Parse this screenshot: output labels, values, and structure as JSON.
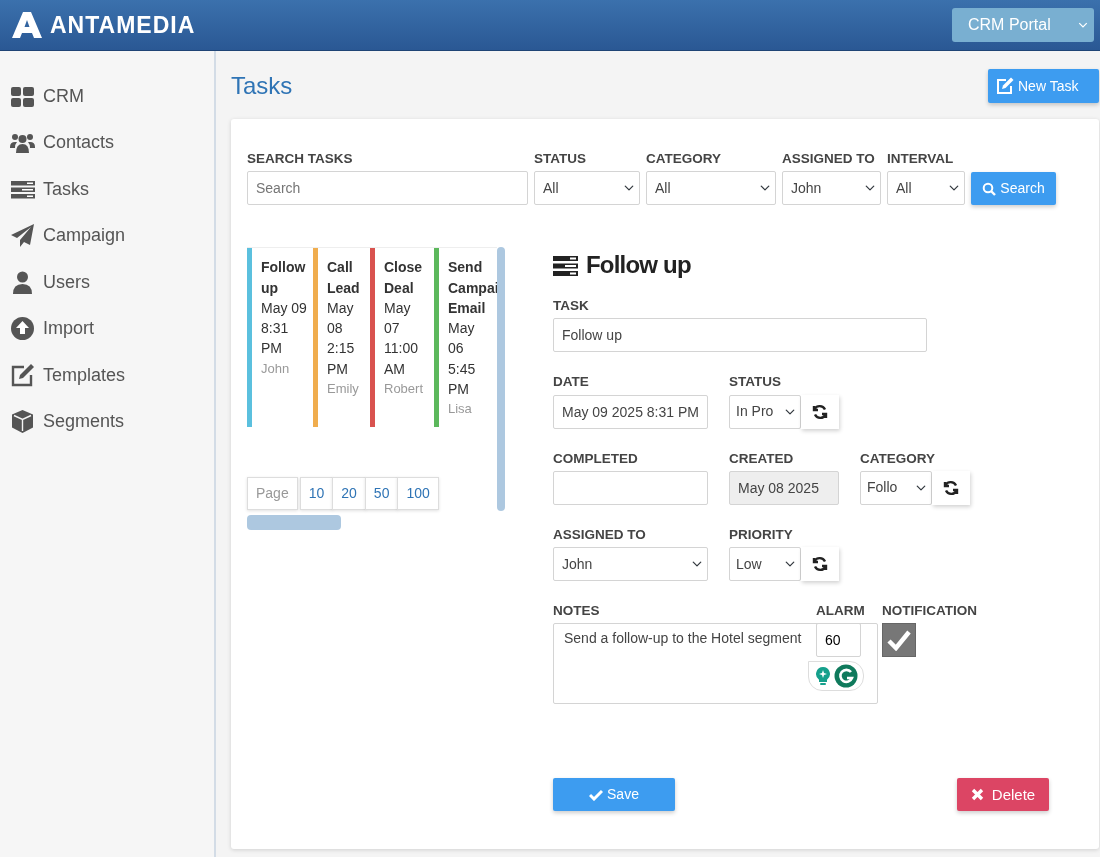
{
  "header": {
    "brand": "ANTAMEDIA",
    "portal_select": "CRM Portal"
  },
  "sidebar": {
    "items": [
      {
        "label": "CRM"
      },
      {
        "label": "Contacts"
      },
      {
        "label": "Tasks"
      },
      {
        "label": "Campaign"
      },
      {
        "label": "Users"
      },
      {
        "label": "Import"
      },
      {
        "label": "Templates"
      },
      {
        "label": "Segments"
      }
    ]
  },
  "page": {
    "title": "Tasks",
    "new_button": "New Task"
  },
  "filters": {
    "search_label": "SEARCH TASKS",
    "search_placeholder": "Search",
    "search_button": "Search",
    "selects": [
      {
        "label": "STATUS",
        "value": "All"
      },
      {
        "label": "CATEGORY",
        "value": "All"
      },
      {
        "label": "ASSIGNED TO",
        "value": "John"
      },
      {
        "label": "INTERVAL",
        "value": "All"
      }
    ]
  },
  "task_cards": [
    {
      "title": "Follow up",
      "date": "May 09 8:31 PM",
      "assignee": "John",
      "color": "#5bc0de"
    },
    {
      "title": "Call Lead",
      "date": "May 08 2:15 PM",
      "assignee": "Emily",
      "color": "#f0ad4e"
    },
    {
      "title": "Close Deal",
      "date": "May 07 11:00 AM",
      "assignee": "Robert",
      "color": "#d9534f"
    },
    {
      "title": "Send Campai Email",
      "date": "May 06 5:45 PM",
      "assignee": "Lisa",
      "color": "#5cb85c"
    }
  ],
  "pagination": {
    "label": "Page",
    "sizes": [
      "10",
      "20",
      "50",
      "100"
    ]
  },
  "detail": {
    "heading": "Follow up",
    "task": {
      "label": "TASK",
      "value": "Follow up"
    },
    "date": {
      "label": "DATE",
      "value": "May 09 2025 8:31 PM"
    },
    "status": {
      "label": "STATUS",
      "value": "In Pro"
    },
    "completed": {
      "label": "COMPLETED"
    },
    "created": {
      "label": "CREATED",
      "value": "May 08 2025"
    },
    "category": {
      "label": "CATEGORY",
      "value": "Follo"
    },
    "assigned_to": {
      "label": "ASSIGNED TO",
      "value": "John"
    },
    "priority": {
      "label": "PRIORITY",
      "value": "Low"
    },
    "notes": {
      "label": "NOTES",
      "value": "Send a follow-up to the Hotel segment"
    },
    "alarm": {
      "label": "ALARM",
      "value": "60"
    },
    "notification": {
      "label": "NOTIFICATION",
      "checked": true
    },
    "save_button": "Save",
    "delete_button": "Delete"
  }
}
